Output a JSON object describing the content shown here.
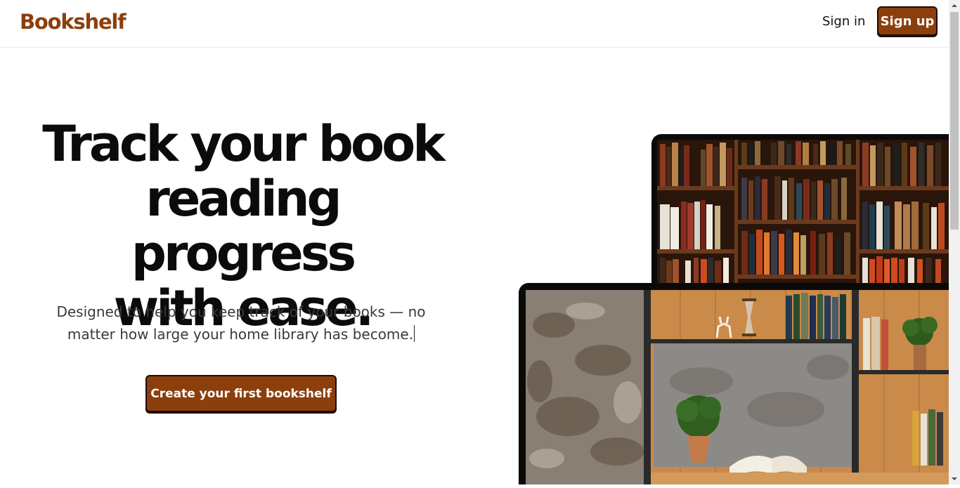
{
  "header": {
    "logo": "Bookshelf",
    "signin_label": "Sign in",
    "signup_label": "Sign up"
  },
  "hero": {
    "headline_line1": "Track your book",
    "headline_line2": "reading progress",
    "headline_line3": "with ease.",
    "subtext_line1": "Designed to help you keep track of your books — no",
    "subtext_line2": "matter how large your home library has become.",
    "cta_label": "Create your first bookshelf"
  },
  "images": {
    "top": "bookshelf-photo",
    "bottom": "home-shelf-photo"
  },
  "colors": {
    "brand": "#8b3f0c",
    "border": "#1f0d02"
  }
}
